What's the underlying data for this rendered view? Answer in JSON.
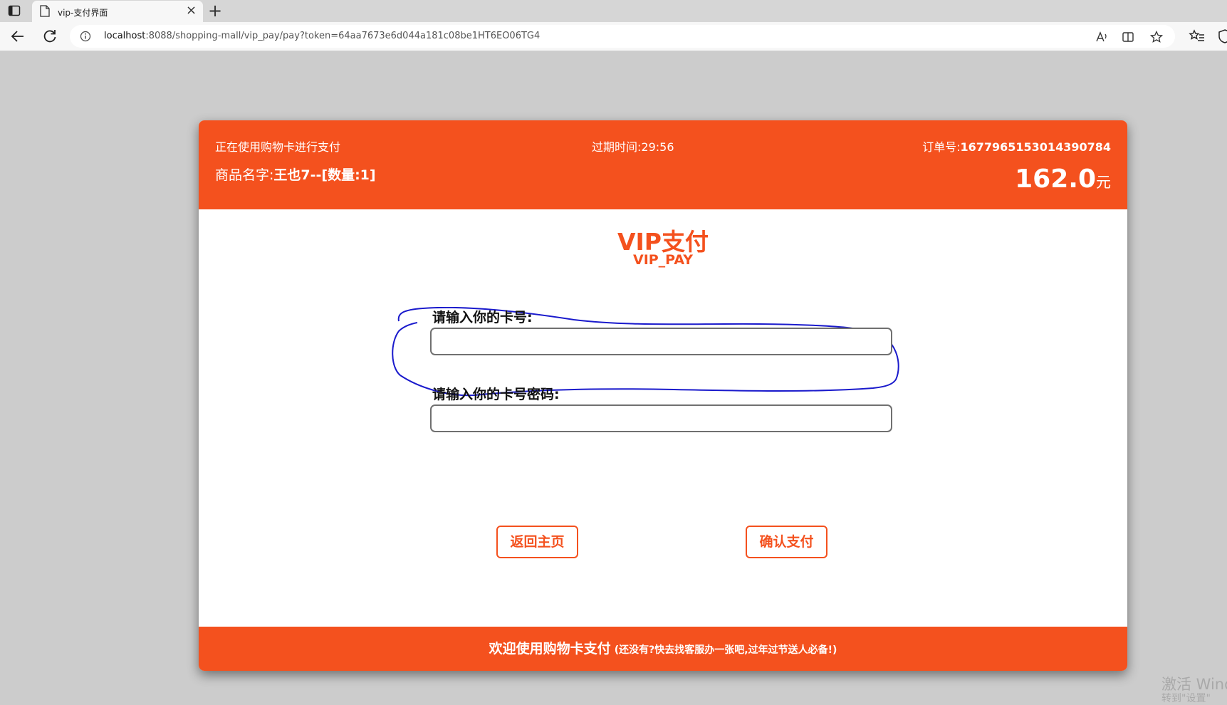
{
  "browser": {
    "tab_title": "vip-支付界面",
    "url_host": "localhost",
    "url_rest": ":8088/shopping-mall/vip_pay/pay?token=64aa7673e6d044a181c08be1HT6EO06TG4"
  },
  "header": {
    "status": "正在使用购物卡进行支付",
    "expire_label": "过期时间:",
    "expire_value": "29:56",
    "order_label": "订单号:",
    "order_number": "1677965153014390784",
    "product_label": "商品名字:",
    "product_name": "王也7--[数量:1]",
    "price": "162.0",
    "currency": "元"
  },
  "title": {
    "cn": "VIP支付",
    "en": "VIP_PAY"
  },
  "form": {
    "card_label": "请输入你的卡号:",
    "card_value": "",
    "password_label": "请输入你的卡号密码:",
    "password_value": ""
  },
  "buttons": {
    "back": "返回主页",
    "confirm": "确认支付"
  },
  "footer": {
    "main": "欢迎使用购物卡支付",
    "sub": "(还没有?快去找客服办一张吧,过年过节送人必备!)"
  },
  "os_watermark": {
    "line1": "激活 Wind",
    "line2": "转到\"设置\""
  },
  "colors": {
    "brand": "#f4511e",
    "annotation": "#1a1acc"
  }
}
